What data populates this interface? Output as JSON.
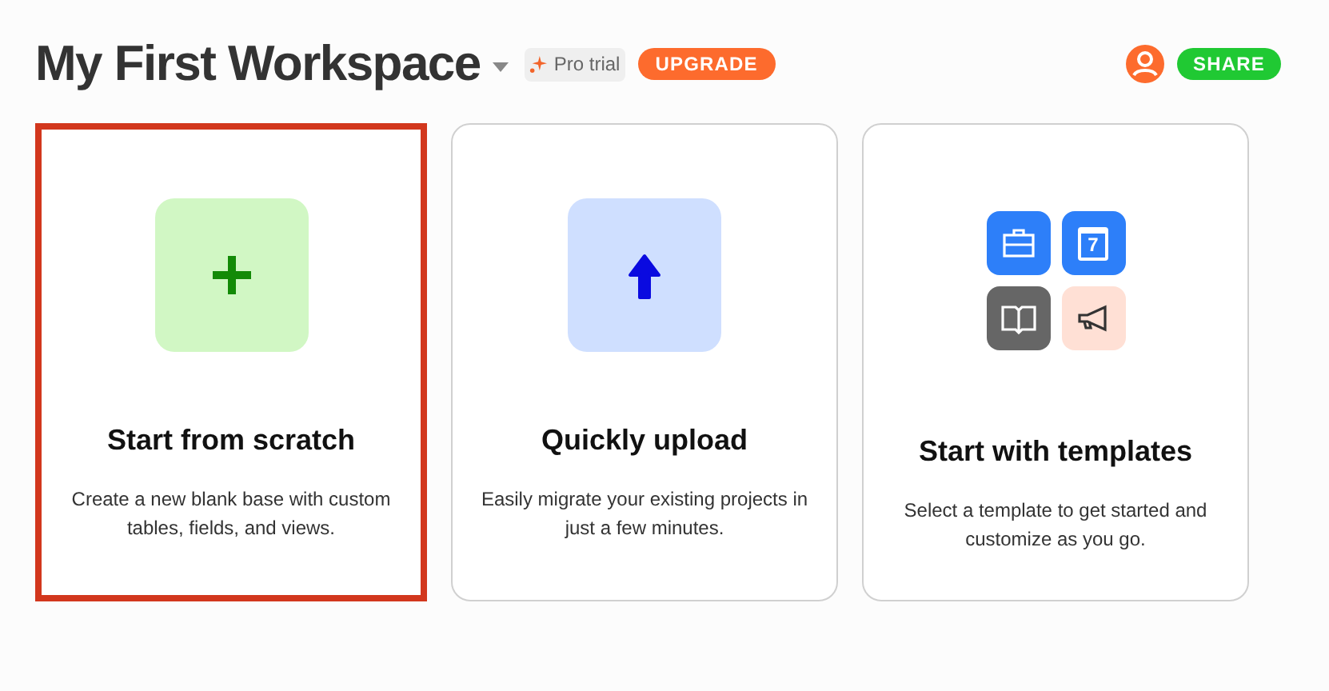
{
  "header": {
    "title": "My First Workspace",
    "badge": "Pro trial",
    "upgrade_button": "UPGRADE",
    "share_button": "SHARE"
  },
  "cards": [
    {
      "kind": "scratch",
      "title": "Start from scratch",
      "description": "Create a new blank base with custom tables, fields, and views.",
      "selected": true
    },
    {
      "kind": "upload",
      "title": "Quickly upload",
      "description": "Easily migrate your existing projects in just a few minutes.",
      "selected": false
    },
    {
      "kind": "templates",
      "title": "Start with templates",
      "description": "Select a template to get started and customize as you go.",
      "selected": false,
      "calendar_day": "7"
    }
  ]
}
